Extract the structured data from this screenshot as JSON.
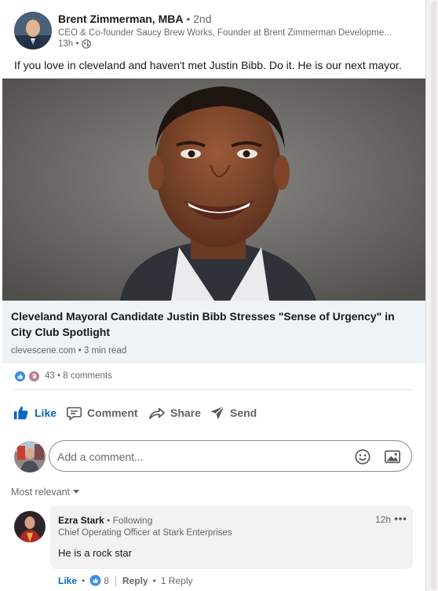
{
  "post": {
    "author_name": "Brent Zimmerman, MBA",
    "degree": "• 2nd",
    "headline": "CEO & Co-founder Saucy Brew Works, Founder at Brent Zimmerman Developme...",
    "time": "13h •",
    "text": "If you love in cleveland and haven't met Justin Bibb. Do it. He is our next mayor."
  },
  "article": {
    "title": "Cleveland Mayoral Candidate Justin Bibb Stresses \"Sense of Urgency\" in City Club Spotlight",
    "source": "clevescene.com • 3 min read"
  },
  "social": {
    "reaction_count": "43",
    "separator": "•",
    "comments_count": "8 comments"
  },
  "actions": {
    "like": "Like",
    "comment": "Comment",
    "share": "Share",
    "send": "Send"
  },
  "comment_box": {
    "placeholder": "Add a comment..."
  },
  "sort": {
    "label": "Most relevant"
  },
  "comment": {
    "author": "Ezra Stark",
    "following": "• Following",
    "headline": "Chief Operating Officer at Stark Enterprises",
    "time": "12h",
    "text": "He is a rock star",
    "like": "Like",
    "like_sep": "•",
    "like_count": "8",
    "reply": "Reply",
    "reply_sep": "•",
    "reply_count": "1 Reply"
  },
  "colors": {
    "linkedin_blue": "#0a66c2",
    "comment_bg": "#f2f2f2",
    "article_bg": "#eef3f8"
  },
  "icons": [
    "globe-icon",
    "like-reaction-icon",
    "celebrate-reaction-icon",
    "thumbs-up-icon",
    "comment-icon",
    "share-icon",
    "send-icon",
    "emoji-icon",
    "image-icon",
    "caret-down-icon",
    "more-icon"
  ]
}
